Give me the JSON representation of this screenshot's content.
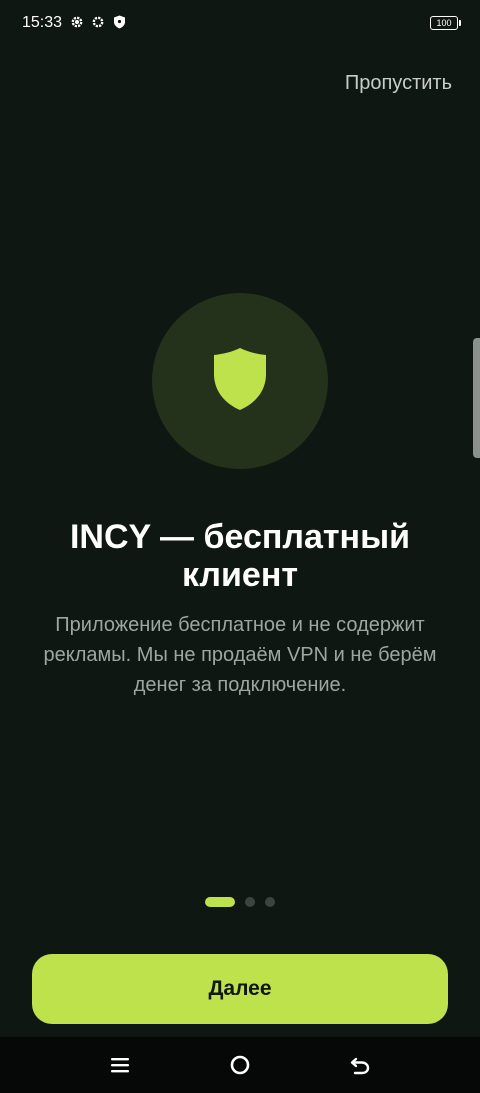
{
  "status_bar": {
    "time": "15:33",
    "icons": [
      "settings-icon",
      "settings-icon",
      "shield-icon"
    ],
    "battery": "100"
  },
  "header": {
    "skip_label": "Пропустить"
  },
  "hero": {
    "icon": "shield-icon",
    "title": "INCY — бесплатный клиент",
    "description": "Приложение бесплатное и не содержит рекламы. Мы не продаём VPN и не берём денег за подключение."
  },
  "pager": {
    "total": 3,
    "active_index": 0
  },
  "actions": {
    "next_label": "Далее"
  },
  "nav_bar": {
    "buttons": [
      "menu-icon",
      "home-icon",
      "back-icon"
    ]
  },
  "colors": {
    "background": "#0e1712",
    "accent": "#bde24c",
    "circle": "#25321b"
  }
}
